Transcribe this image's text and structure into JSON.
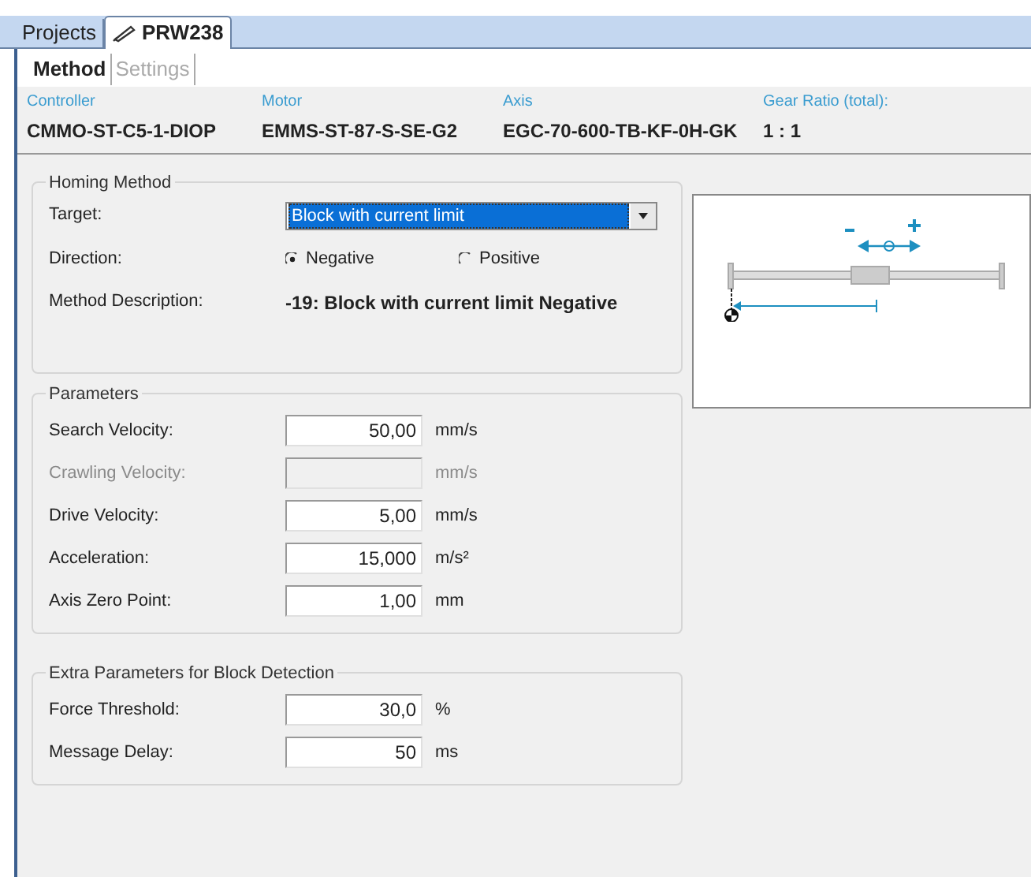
{
  "tabs": [
    {
      "label": "Projects",
      "selected": false,
      "icon": false
    },
    {
      "label": "PRW238",
      "selected": true,
      "icon": true
    }
  ],
  "subtabs": [
    {
      "label": "Method",
      "selected": true
    },
    {
      "label": "Settings",
      "selected": false
    }
  ],
  "info": [
    {
      "label": "Controller",
      "value": "CMMO-ST-C5-1-DIOP"
    },
    {
      "label": "Motor",
      "value": "EMMS-ST-87-S-SE-G2"
    },
    {
      "label": "Axis",
      "value": "EGC-70-600-TB-KF-0H-GK"
    },
    {
      "label": "Gear Ratio (total):",
      "value": "1 : 1"
    }
  ],
  "homing": {
    "title": "Homing Method",
    "target_label": "Target:",
    "target_value": "Block with current limit",
    "direction_label": "Direction:",
    "directions": [
      {
        "label": "Negative",
        "selected": true
      },
      {
        "label": "Positive",
        "selected": false
      }
    ],
    "description_label": "Method Description:",
    "description": "-19: Block with current limit Negative"
  },
  "groups": [
    {
      "title": "Parameters",
      "rows": [
        {
          "label": "Search Velocity:",
          "value": "50,00",
          "unit": "mm/s",
          "disabled": false
        },
        {
          "label": "Crawling Velocity:",
          "unit": "mm/s",
          "disabled": true
        },
        {
          "label": "Drive Velocity:",
          "value": "5,00",
          "unit": "mm/s",
          "disabled": false
        },
        {
          "label": "Acceleration:",
          "value": "15,000",
          "unit": "m/s²",
          "disabled": false
        },
        {
          "label": "Axis Zero Point:",
          "value": "1,00",
          "unit": "mm",
          "disabled": false
        }
      ]
    },
    {
      "title": "Extra Parameters for Block Detection",
      "rows": [
        {
          "label": "Force Threshold:",
          "value": "30,0",
          "unit": "%",
          "disabled": false
        },
        {
          "label": "Message Delay:",
          "value": "50",
          "unit": "ms",
          "disabled": false
        }
      ]
    }
  ]
}
